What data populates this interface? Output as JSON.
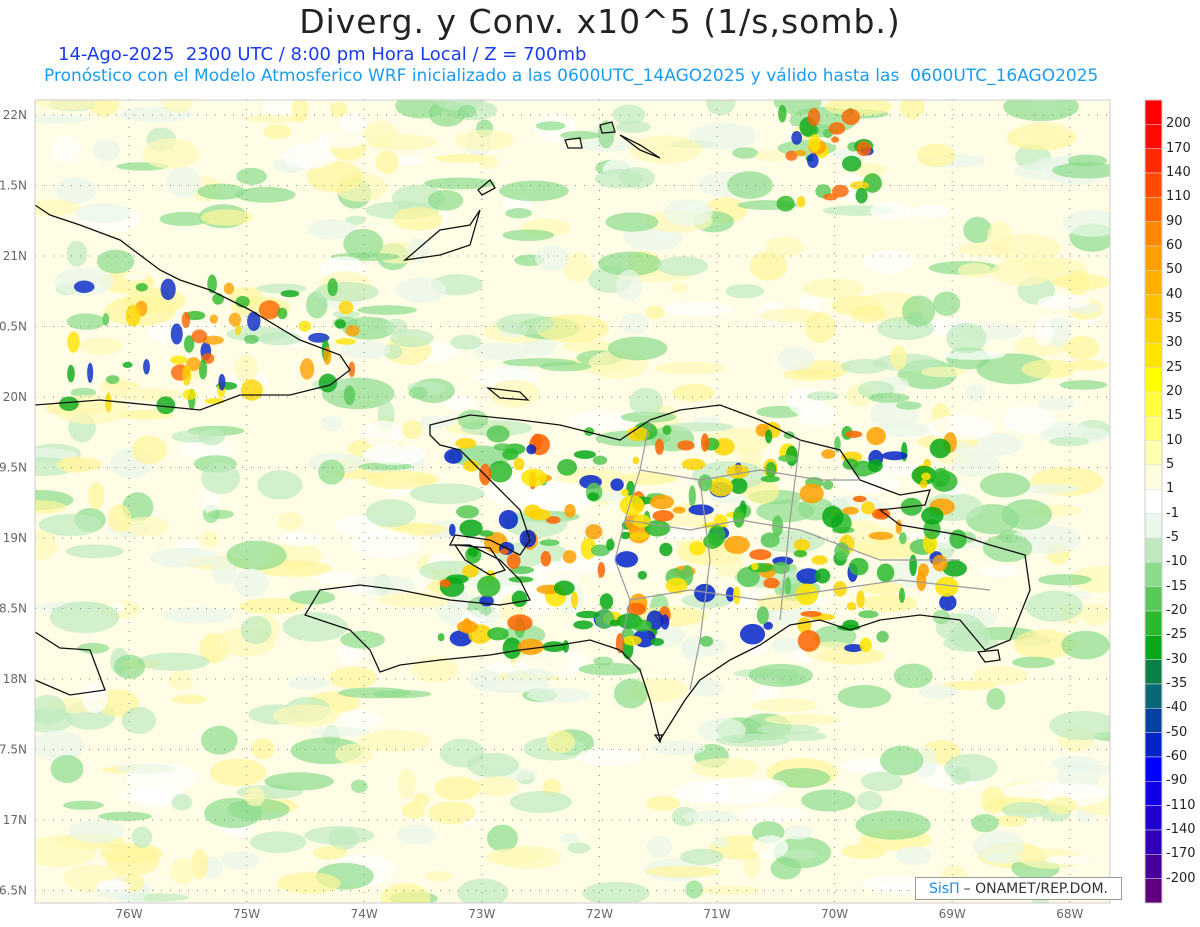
{
  "title": "Diverg. y Conv. x10^5 (1/s,somb.)",
  "line1": "14-Ago-2025  2300 UTC / 8:00 pm Hora Local / Z = 700mb",
  "line2": "Pronóstico con el Modelo Atmosferico WRF inicializado a las 0600UTC_14AGO2025 y válido hasta las  0600UTC_16AGO2025",
  "lon_labels": [
    "76W",
    "75W",
    "74W",
    "73W",
    "72W",
    "71W",
    "70W",
    "69W",
    "68W"
  ],
  "lat_labels": [
    "22N",
    "1.5N",
    "21N",
    "0.5N",
    "20N",
    "9.5N",
    "19N",
    "8.5N",
    "18N",
    "7.5N",
    "17N",
    "6.5N"
  ],
  "colorbar": {
    "labels": [
      "200",
      "170",
      "140",
      "110",
      "90",
      "60",
      "50",
      "40",
      "35",
      "30",
      "25",
      "20",
      "15",
      "10",
      "5",
      "1",
      "-1",
      "-5",
      "-10",
      "-15",
      "-20",
      "-25",
      "-30",
      "-35",
      "-40",
      "-50",
      "-60",
      "-90",
      "-110",
      "-140",
      "-170",
      "-200"
    ],
    "colors": [
      "#ff0000",
      "#ff0a00",
      "#ff2a00",
      "#ff4a00",
      "#ff6400",
      "#ff8800",
      "#ffa000",
      "#ffb000",
      "#ffc000",
      "#ffd400",
      "#ffe400",
      "#ffff00",
      "#ffff40",
      "#ffff78",
      "#ffffb0",
      "#fffde0",
      "#ffffff",
      "#eaf7ea",
      "#bfe9bf",
      "#8cdb8c",
      "#58c858",
      "#2cb82c",
      "#08a818",
      "#0a8048",
      "#086878",
      "#0444a0",
      "#0424c8",
      "#0000ff",
      "#1000e8",
      "#2000d0",
      "#3000b8",
      "#480098",
      "#600080"
    ]
  },
  "credit": {
    "brand": "SisΠ",
    "text": "– ONAMET/REP.DOM."
  }
}
